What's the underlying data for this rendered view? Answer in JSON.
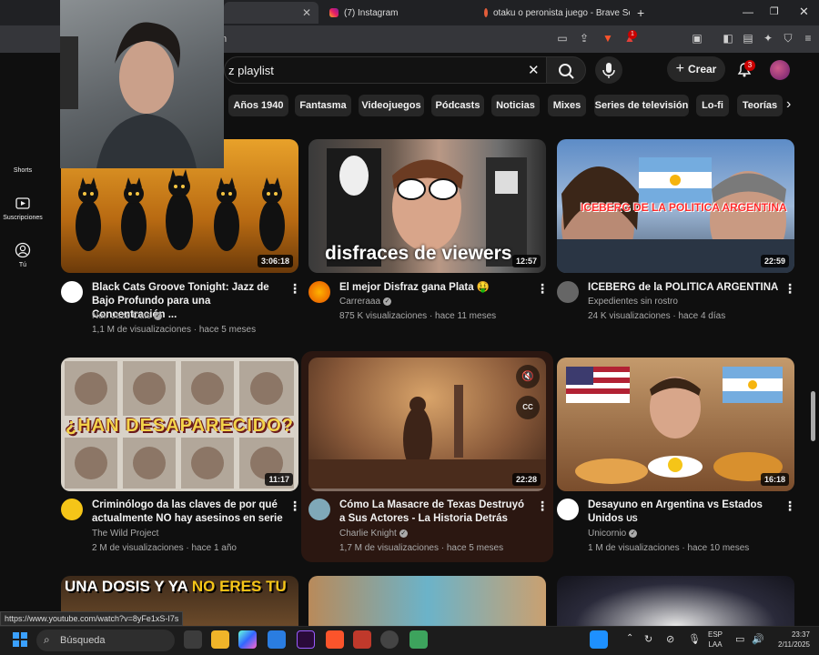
{
  "browser": {
    "tabs": [
      {
        "label": "",
        "active": true
      },
      {
        "label": "(7) Instagram",
        "active": false
      },
      {
        "label": "otaku o peronista juego - Brave Sear",
        "active": false
      }
    ],
    "url_fragment": "m",
    "brave_badge": "1"
  },
  "header": {
    "search_query": "z playlist",
    "create_label": "Crear",
    "notifications_count": "3"
  },
  "chips": [
    "Años 1940",
    "Fantasma",
    "Videojuegos",
    "Pódcasts",
    "Noticias",
    "Mixes",
    "Series de televisión",
    "Lo-fi",
    "Teorías"
  ],
  "sidebar": {
    "items": [
      {
        "label": "Shorts"
      },
      {
        "label": "Suscripciones"
      },
      {
        "label": "Tú"
      }
    ]
  },
  "videos": [
    {
      "title": "Black Cats Groove Tonight: Jazz de Bajo Profundo para una Concentración ...",
      "channel": "Noir Jazz Cats",
      "meta": "1,1 M de visualizaciones · hace 5 meses",
      "duration": "3:06:18",
      "thumb_text": ""
    },
    {
      "title": "El mejor Disfraz gana Plata 🤑",
      "channel": "Carreraaa",
      "meta": "875 K visualizaciones · hace 11 meses",
      "duration": "12:57",
      "thumb_text": "disfraces de viewers"
    },
    {
      "title": "ICEBERG de la POLITICA ARGENTINA",
      "channel": "Expedientes sin rostro",
      "meta": "24 K visualizaciones · hace 4 días",
      "duration": "22:59",
      "thumb_text": "ICEBERG DE LA POLITICA ARGENTINA"
    },
    {
      "title": "Criminólogo da las claves de por qué actualmente NO hay asesinos en serie",
      "channel": "The Wild Project",
      "meta": "2 M de visualizaciones · hace 1 año",
      "duration": "11:17",
      "thumb_text": "¿HAN DESAPARECIDO?"
    },
    {
      "title": "Cómo La Masacre de Texas Destruyó a Sus Actores -  La Historia Detrás",
      "channel": "Charlie Knight",
      "meta": "1,7 M de visualizaciones · hace 5 meses",
      "duration": "22:28",
      "thumb_text": ""
    },
    {
      "title": "Desayuno en Argentina vs Estados Unidos",
      "title_suffix": "US",
      "channel": "Unicornio",
      "meta": "1 M de visualizaciones · hace 10 meses",
      "duration": "16:18",
      "thumb_text": ""
    }
  ],
  "row3_thumb_text": {
    "part1": "UNA DOSIS Y YA ",
    "part2": "NO ERES TU"
  },
  "status_url": "https://www.youtube.com/watch?v=8yFe1xS-I7s",
  "taskbar": {
    "search_placeholder": "Búsqueda",
    "lang": "ESP",
    "lang2": "LAA",
    "time": "23:37",
    "date": "2/11/2025"
  },
  "colors": {
    "accent": "#cc0000",
    "background": "#0f0f0f",
    "chip": "#272727"
  }
}
